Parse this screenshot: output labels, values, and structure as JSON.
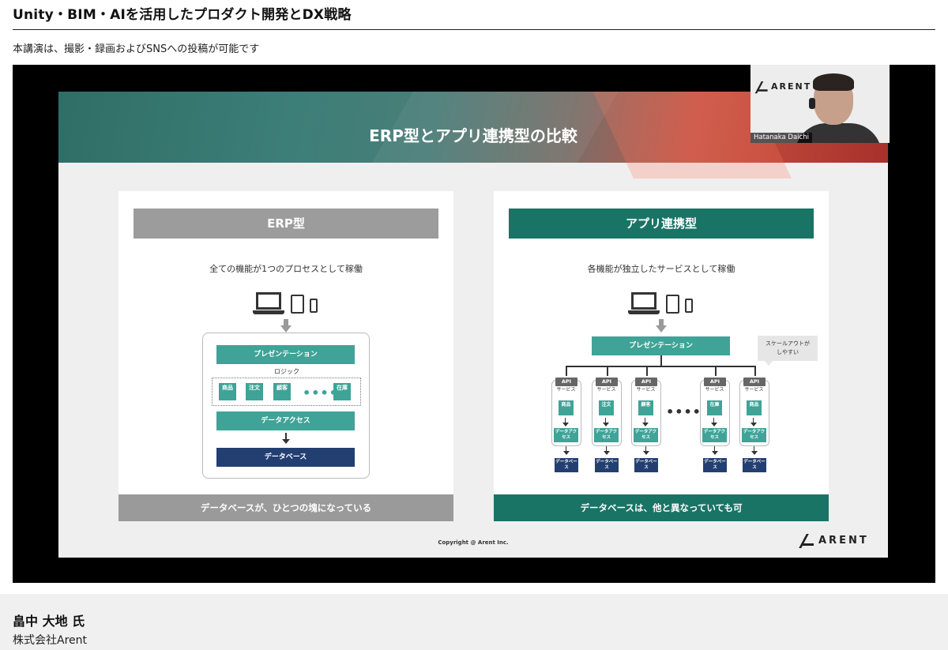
{
  "page": {
    "title": "Unity・BIM・AIを活用したプロダクト開発とDX戦略",
    "notice": "本講演は、撮影・録画およびSNSへの投稿が可能です"
  },
  "slide": {
    "title": "ERP型とアプリ連携型の比較",
    "erp": {
      "heading": "ERP型",
      "subtitle": "全ての機能が1つのプロセスとして稼働",
      "presentation": "プレゼンテーション",
      "logic": "ロジック",
      "modules": [
        "商品",
        "注文",
        "顧客",
        "在庫"
      ],
      "dots": "••••",
      "data_access": "データアクセス",
      "database": "データベース",
      "footer": "データベースが、ひとつの塊になっている"
    },
    "app": {
      "heading": "アプリ連携型",
      "subtitle": "各機能が独立したサービスとして稼働",
      "presentation": "プレゼンテーション",
      "bubble": "スケールアウトが\nしやすい",
      "api": "API",
      "service_label": "サービス",
      "data_access": "データアクセス",
      "database": "データベース",
      "services": [
        "商品",
        "注文",
        "顧客",
        "在庫",
        "商品"
      ],
      "dots": "•••••",
      "footer": "データベースは、他と異なっていても可"
    },
    "copyright": "Copyright @ Arent Inc.",
    "brand": "ARENT"
  },
  "pip": {
    "brand": "ARENT",
    "name": "Hatanaka Daichi"
  },
  "speaker": {
    "name": "畠中 大地 氏",
    "org": "株式会社Arent"
  },
  "colors": {
    "teal": "#3fa397",
    "dark_teal": "#197466",
    "navy": "#233f72",
    "gray": "#9c9c9c"
  }
}
